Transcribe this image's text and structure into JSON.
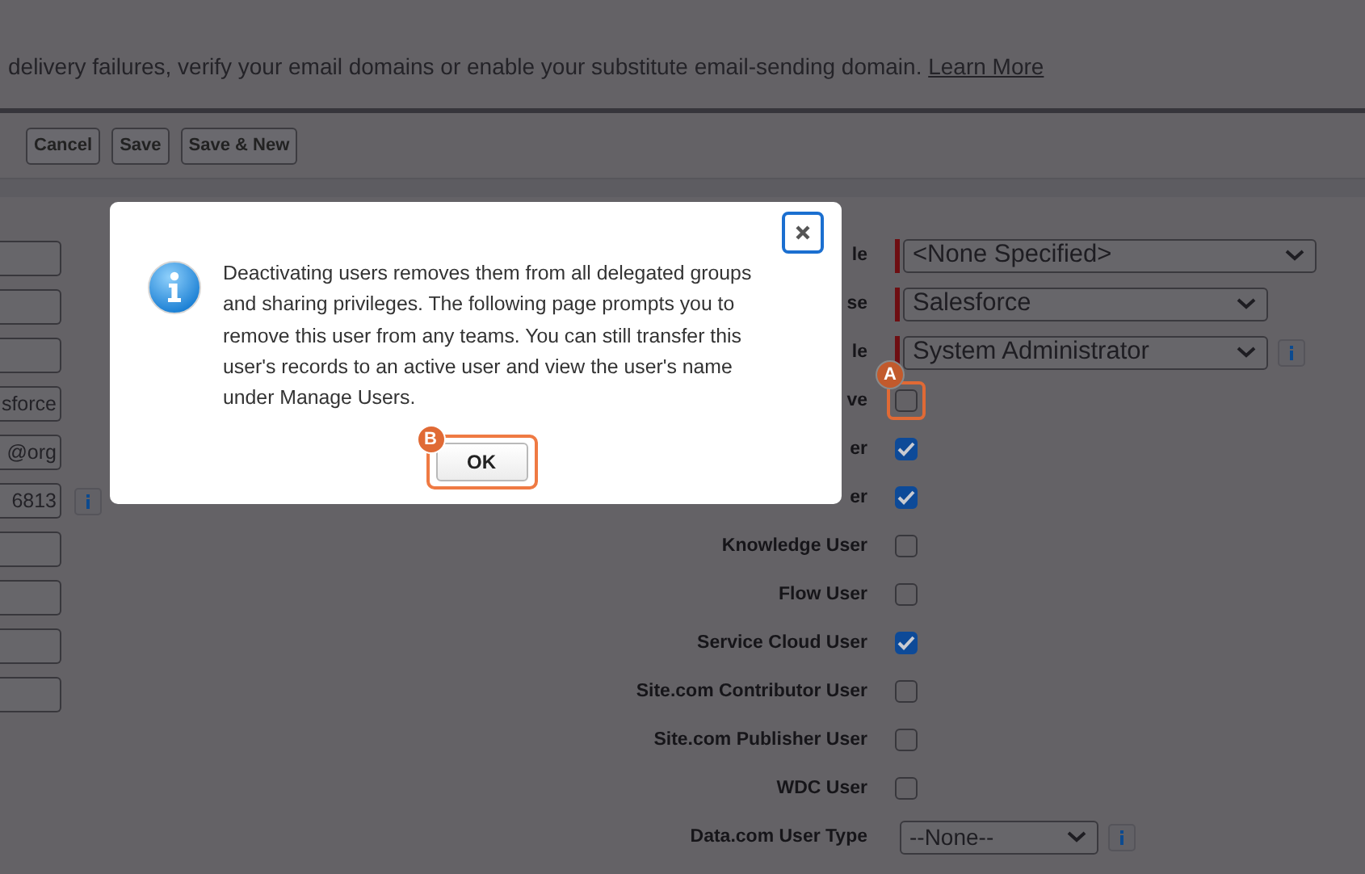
{
  "banner": {
    "text": "delivery failures, verify your email domains or enable your substitute email-sending domain.",
    "link": "Learn More"
  },
  "toolbar": {
    "buttons": [
      "Cancel",
      "Save",
      "Save & New"
    ]
  },
  "left_fields": [
    {
      "info": false
    },
    {
      "info": false
    },
    {
      "info": false
    },
    {
      "value": "sforce",
      "info": false
    },
    {
      "value": "@org",
      "info": false
    },
    {
      "value": "6813",
      "info": true
    },
    {
      "info": false
    },
    {
      "info": false
    },
    {
      "info": false
    },
    {
      "info": false
    }
  ],
  "form_rows": [
    {
      "kind": "select",
      "label": "le",
      "value": "<None Specified>",
      "required": true,
      "info": false
    },
    {
      "kind": "select",
      "label": "se",
      "value": "Salesforce",
      "required": true,
      "info": false
    },
    {
      "kind": "select",
      "label": "le",
      "value": "System Administrator",
      "required": true,
      "info": true
    },
    {
      "kind": "checkbox",
      "label": "ve",
      "checked": false,
      "annotation": "A"
    },
    {
      "kind": "checkbox",
      "label": "er",
      "checked": true
    },
    {
      "kind": "checkbox",
      "label": "er",
      "checked": true
    },
    {
      "kind": "checkbox",
      "label": "Knowledge User",
      "checked": false
    },
    {
      "kind": "checkbox",
      "label": "Flow User",
      "checked": false
    },
    {
      "kind": "checkbox",
      "label": "Service Cloud User",
      "checked": true
    },
    {
      "kind": "checkbox",
      "label": "Site.com Contributor User",
      "checked": false
    },
    {
      "kind": "checkbox",
      "label": "Site.com Publisher User",
      "checked": false
    },
    {
      "kind": "checkbox",
      "label": "WDC User",
      "checked": false
    },
    {
      "kind": "select",
      "label": "Data.com User Type",
      "value": "--None--",
      "required": false,
      "info": true
    }
  ],
  "dialog": {
    "message": "Deactivating users removes them from all delegated groups and sharing privileges. The following page prompts you to remove this user from any teams. You can still transfer this user's records to an active user and view the user's name under Manage Users.",
    "ok_button": "OK",
    "ok_annotation": "B"
  }
}
